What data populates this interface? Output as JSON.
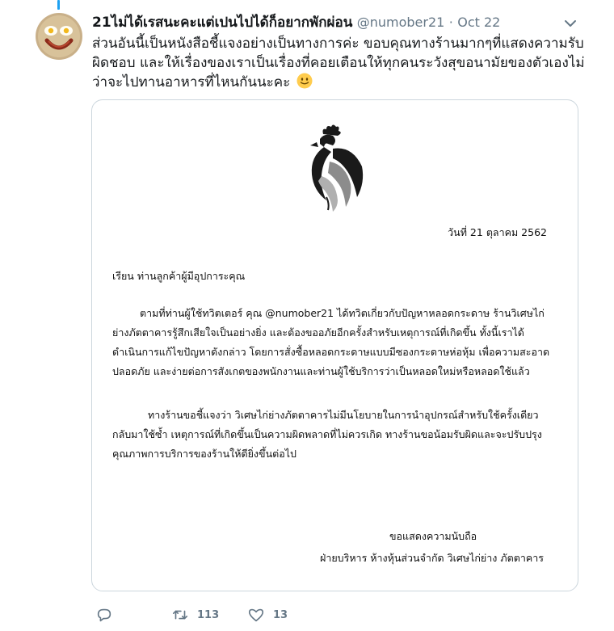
{
  "tweet": {
    "display_name": "21ไม่ได้เรสนะคะแต่เปนไปได้ก็อยากพักผ่อน",
    "handle": "@numober21",
    "separator": "·",
    "date": "Oct 22",
    "text": "ส่วนอันนี้เป็นหนังสือชี้แจงอย่างเป็นทางการค่ะ ขอบคุณทางร้านมากๆที่แสดงความรับผิดชอบ และให้เรื่องของเราเป็นเรื่องที่คอยเตือนให้ทุกคนระวังสุขอนามัยของตัวเองไม่ว่าจะไปทานอาหารที่ไหนกันนะคะ",
    "emoji": "slightly-smiling-face",
    "actions": {
      "reply_count": "",
      "retweet_count": "113",
      "like_count": "13"
    }
  },
  "letter": {
    "date": "วันที่ 21 ตุลาคม 2562",
    "salutation": "เรียน ท่านลูกค้าผู้มีอุปการะคุณ",
    "paragraph_1": "ตามที่ท่านผู้ใช้ทวิตเตอร์ คุณ @numober21 ได้ทวิตเกี่ยวกับปัญหาหลอดกระดาษ ร้านวิเศษไก่ย่างภัตตาคารรู้สึกเสียใจเป็นอย่างยิ่ง และต้องขออภัยอีกครั้งสำหรับเหตุการณ์ที่เกิดขึ้น ทั้งนี้เราได้ดำเนินการแก้ไขปัญหาดังกล่าว โดยการสั่งซื้อหลอดกระดาษแบบมีซองกระดาษห่อหุ้ม เพื่อความสะอาดปลอดภัย และง่ายต่อการสังเกตของพนักงานและท่านผู้ใช้บริการว่าเป็นหลอดใหม่หรือหลอดใช้แล้ว",
    "paragraph_2": "ทางร้านขอชี้แจงว่า วิเศษไก่ย่างภัตตาคารไม่มีนโยบายในการนำอุปกรณ์สำหรับใช้ครั้งเดียวกลับมาใช้ซ้ำ เหตุการณ์ที่เกิดขึ้นเป็นความผิดพลาดที่ไม่ควรเกิด ทางร้านขอน้อมรับผิดและจะปรับปรุงคุณภาพการบริการของร้านให้ดียิ่งขึ้นต่อไป",
    "closing": "ขอแสดงความนับถือ",
    "signature": "ฝ่ายบริหาร ห้างหุ้นส่วนจำกัด วิเศษไก่ย่าง ภัตตาคาร"
  },
  "colors": {
    "text": "#14171a",
    "muted": "#657786",
    "accent": "#1da1f2",
    "border": "#ccd6dd"
  }
}
